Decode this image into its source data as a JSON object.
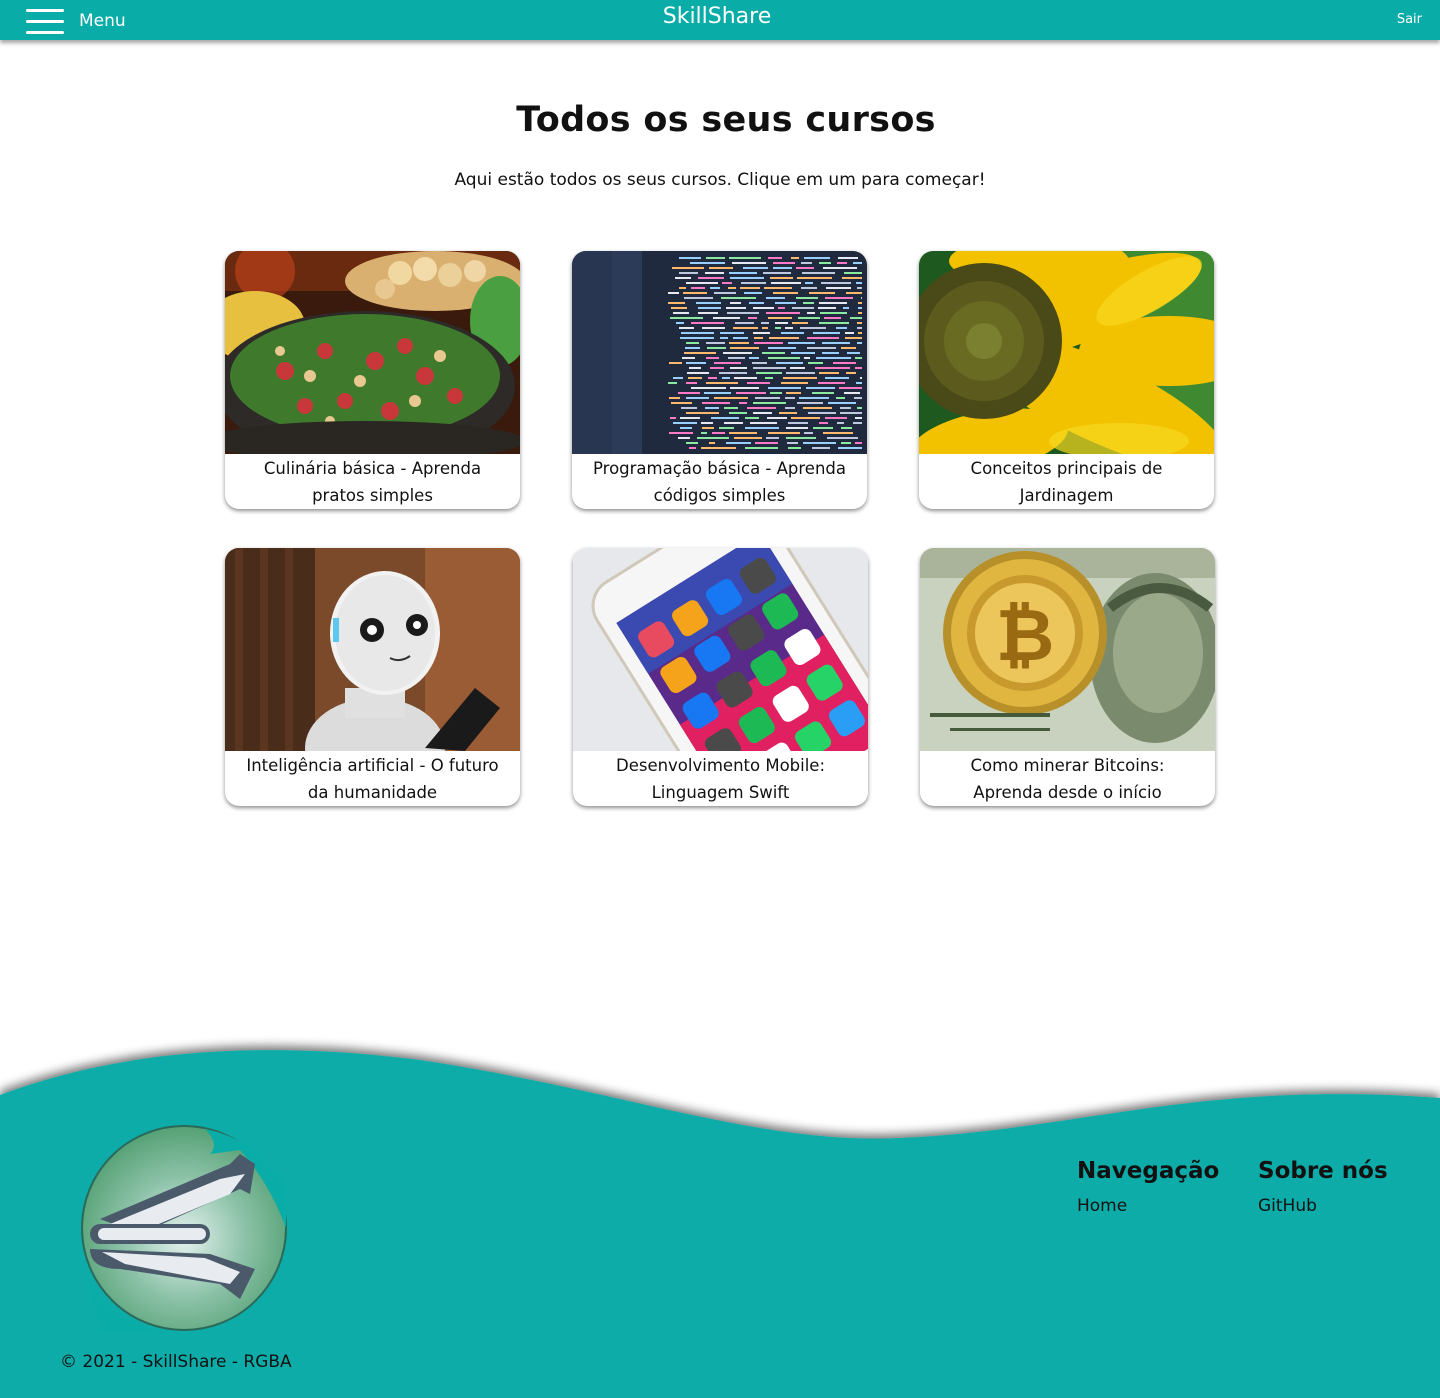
{
  "header": {
    "menu_label": "Menu",
    "brand": "SkillShare",
    "logout_label": "Sair",
    "bar_color": "#0aaca8"
  },
  "main": {
    "title": "Todos os seus cursos",
    "subtitle": "Aqui estão todos os seus cursos. Clique em um para começar!"
  },
  "courses": [
    {
      "title": "Culinária básica - Aprenda pratos simples",
      "image": "food-dish-image"
    },
    {
      "title": "Programação básica - Aprenda códigos simples",
      "image": "code-screen-image"
    },
    {
      "title": "Conceitos principais de Jardinagem",
      "image": "sunflower-image"
    },
    {
      "title": "Inteligência artificial - O futuro da humanidade",
      "image": "robot-image"
    },
    {
      "title": "Desenvolvimento Mobile: Linguagem Swift",
      "image": "smartphone-image"
    },
    {
      "title": "Como minerar Bitcoins: Aprenda desde o início",
      "image": "bitcoin-image"
    }
  ],
  "footer": {
    "nav_heading": "Navegação",
    "nav_links": [
      "Home"
    ],
    "about_heading": "Sobre nós",
    "about_links": [
      "GitHub"
    ],
    "copyright": "© 2021 - SkillShare - RGBA",
    "logo": "skillshare-logo-icon"
  }
}
